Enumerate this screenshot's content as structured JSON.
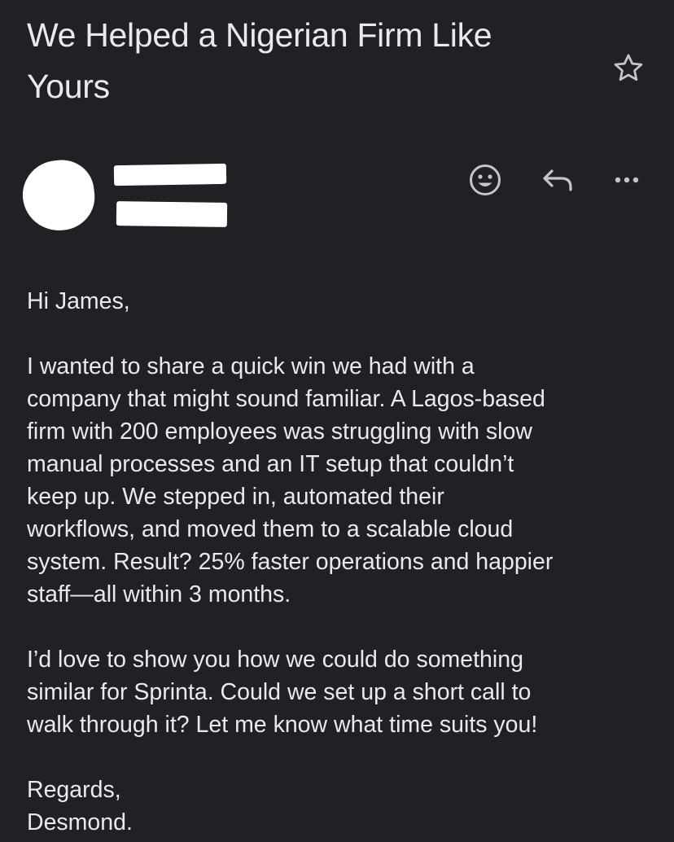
{
  "email": {
    "subject": "We Helped a Nigerian Firm Like Yours",
    "actions": {
      "star_icon": "star-outline-icon",
      "emoji_icon": "emoji-reaction-icon",
      "reply_icon": "reply-icon",
      "more_icon": "more-horizontal-icon"
    },
    "body": {
      "greeting": "Hi James,",
      "paragraph1": "I wanted to share a quick win we had with a\ncompany that might sound familiar. A Lagos-based\nfirm with 200 employees was struggling with slow\nmanual processes and an IT setup that couldn’t\nkeep up. We stepped in, automated their\nworkflows, and moved them to a scalable cloud\nsystem. Result? 25% faster operations and happier\nstaff—all within 3 months.",
      "paragraph2": "I’d love to show you how we could do something\nsimilar for Sprinta. Could we set up a short call to\nwalk through it? Let me know what time suits you!",
      "closing": "Regards,\nDesmond."
    }
  },
  "colors": {
    "background": "#202124",
    "text": "#e8eaed",
    "icon": "#c4c7c5",
    "redaction": "#ffffff"
  }
}
